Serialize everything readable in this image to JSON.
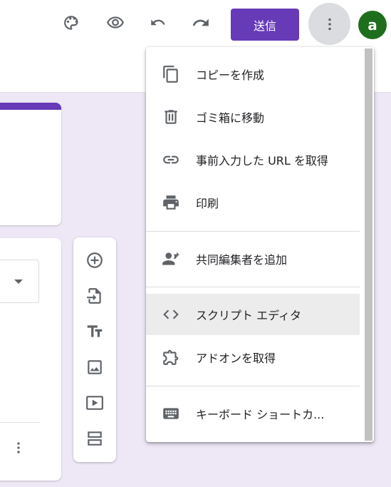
{
  "header": {
    "send_label": "送信",
    "avatar_letter": "a"
  },
  "menu": {
    "items": [
      {
        "label": "コピーを作成",
        "icon": "copy-icon"
      },
      {
        "label": "ゴミ箱に移動",
        "icon": "trash-icon"
      },
      {
        "label": "事前入力した URL を取得",
        "icon": "link-icon"
      },
      {
        "label": "印刷",
        "icon": "print-icon"
      },
      {
        "label": "共同編集者を追加",
        "icon": "add-people-icon"
      },
      {
        "label": "スクリプト エディタ",
        "icon": "code-icon"
      },
      {
        "label": "アドオンを取得",
        "icon": "puzzle-icon"
      },
      {
        "label": "キーボード ショートカ...",
        "icon": "keyboard-icon"
      }
    ],
    "highlighted": "スクリプト エディタ"
  },
  "toolbox": {
    "tools": [
      "add-question-icon",
      "import-questions-icon",
      "add-title-icon",
      "add-image-icon",
      "add-video-icon",
      "add-section-icon"
    ]
  },
  "colors": {
    "accent": "#673ab7",
    "background": "#ede7f6",
    "avatar": "#1e6e1e",
    "highlight": "#ececec"
  }
}
